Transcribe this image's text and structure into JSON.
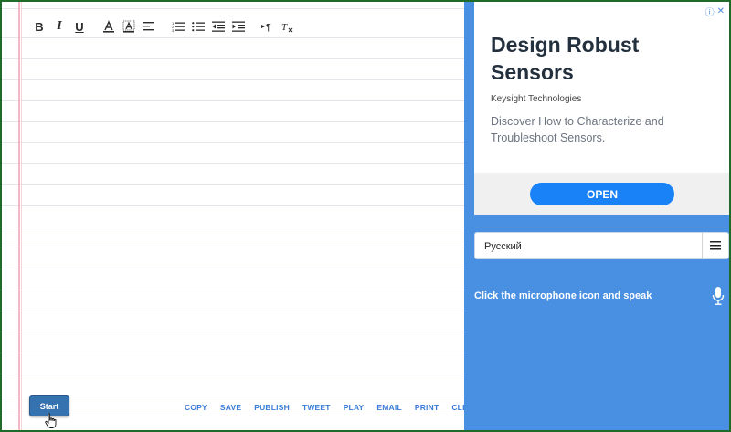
{
  "toolbar": {
    "bold_label": "B",
    "italic_label": "I",
    "underline_label": "U"
  },
  "start_button": {
    "label": "Start"
  },
  "actions": [
    "COPY",
    "SAVE",
    "PUBLISH",
    "TWEET",
    "PLAY",
    "EMAIL",
    "PRINT",
    "CLEAR"
  ],
  "ad": {
    "title": "Design Robust Sensors",
    "advertiser": "Keysight Technologies",
    "description": "Discover How to Characterize and Troubleshoot Sensors.",
    "cta": "OPEN",
    "info_icon": "ⓘ",
    "close_icon": "✕"
  },
  "language": {
    "selected": "Русский"
  },
  "mic": {
    "prompt": "Click the microphone icon and speak"
  },
  "colors": {
    "panel_blue": "#4a90e2",
    "start_button": "#3572b0",
    "action_link": "#3a7bd5",
    "ad_cta": "#1a82f7",
    "window_border": "#1e6b2a"
  }
}
